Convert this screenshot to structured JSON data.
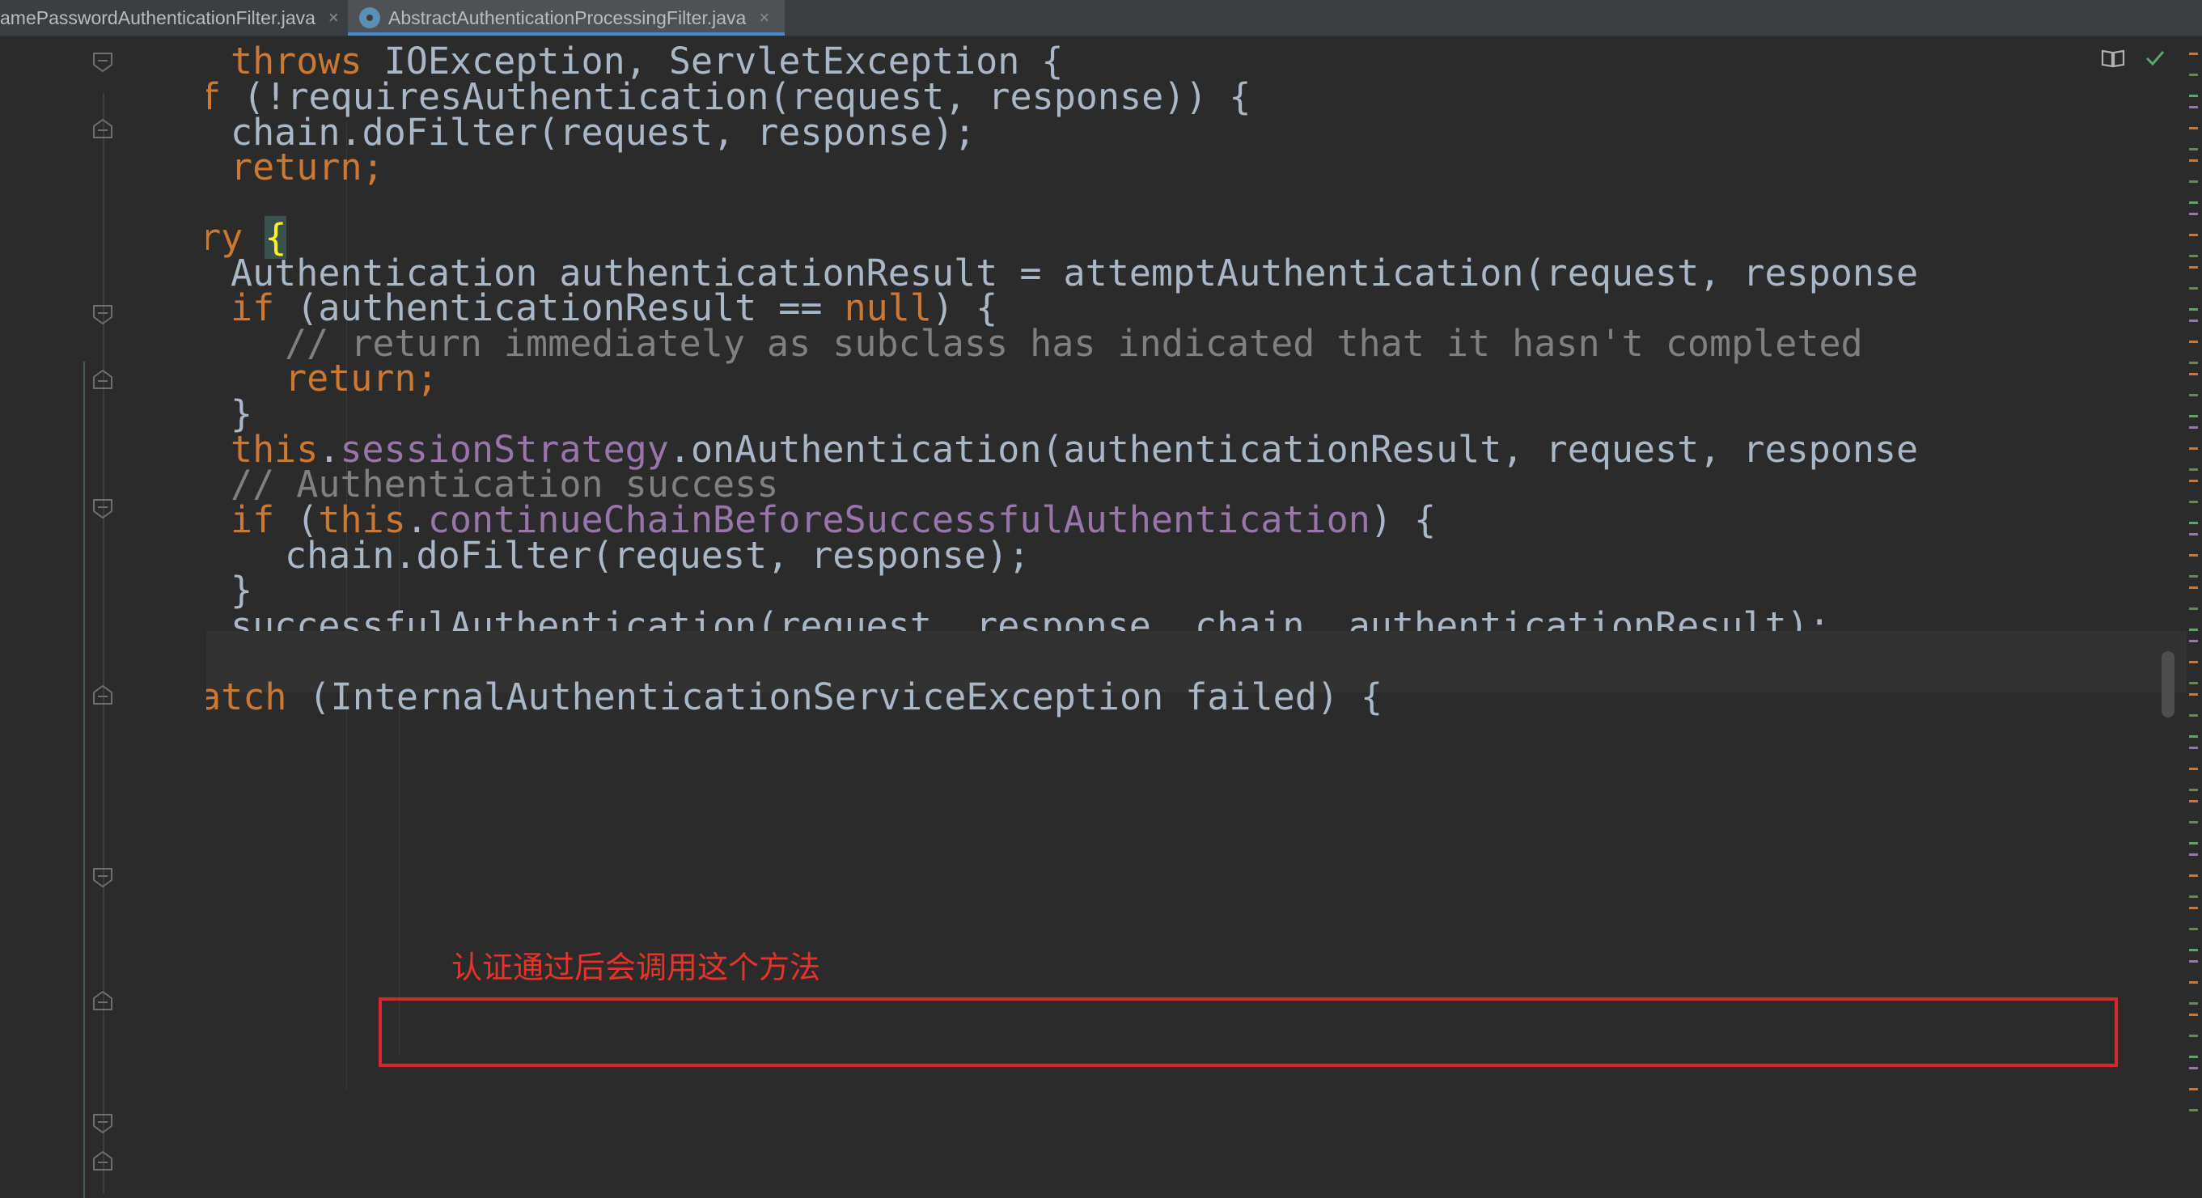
{
  "tabs": [
    {
      "label": "amePasswordAuthenticationFilter.java",
      "close": "×",
      "active": false
    },
    {
      "label": "AbstractAuthenticationProcessingFilter.java",
      "close": "×",
      "active": true
    }
  ],
  "code": {
    "l1": {
      "kw": "throws",
      "rest": " IOException, ServletException {"
    },
    "l2": {
      "kw": "if",
      "rest": " (!requiresAuthentication(request, response)) {"
    },
    "l3": {
      "text": "chain.doFilter(request, response);"
    },
    "l4": {
      "kw": "return;"
    },
    "l5": {
      "text": "}"
    },
    "l6": {
      "kw": "try",
      "space": " ",
      "brace": "{"
    },
    "l7": {
      "text": "Authentication authenticationResult = attemptAuthentication(request, response"
    },
    "l8": {
      "kw": "if",
      "pre": " (authenticationResult == ",
      "kw2": "null",
      "post": ") {"
    },
    "l9": {
      "comment": "// return immediately as subclass has indicated that it hasn't completed"
    },
    "l10": {
      "kw": "return;"
    },
    "l11": {
      "text": "}"
    },
    "l12": {
      "kw": "this",
      "dot": ".",
      "field": "sessionStrategy",
      "rest": ".onAuthentication(authenticationResult, request, response"
    },
    "l13": {
      "comment": "// Authentication success"
    },
    "l14": {
      "kw": "if",
      "pre": " (",
      "kw2": "this",
      "dot": ".",
      "field": "continueChainBeforeSuccessfulAuthentication",
      "post": ") {"
    },
    "l15": {
      "text": "chain.doFilter(request, response);"
    },
    "l16": {
      "text": "}"
    },
    "l17": {
      "text": "successfulAuthentication(request, response, chain, authenticationResult);"
    },
    "l18": {
      "brace": "}"
    },
    "l19": {
      "kw": "catch",
      "rest": " (InternalAuthenticationServiceException failed) {"
    }
  },
  "annotation": "认证通过后会调用这个方法",
  "colors": {
    "background": "#2b2b2b",
    "keyword": "#cc7832",
    "text": "#a9b7c6",
    "comment": "#808080",
    "field": "#9876aa",
    "annotation": "#e8332a",
    "highlight_box": "#d9262b"
  },
  "icons": [
    "file-class-icon",
    "close-icon",
    "reader-mode-icon",
    "check-icon",
    "fold-icon"
  ]
}
